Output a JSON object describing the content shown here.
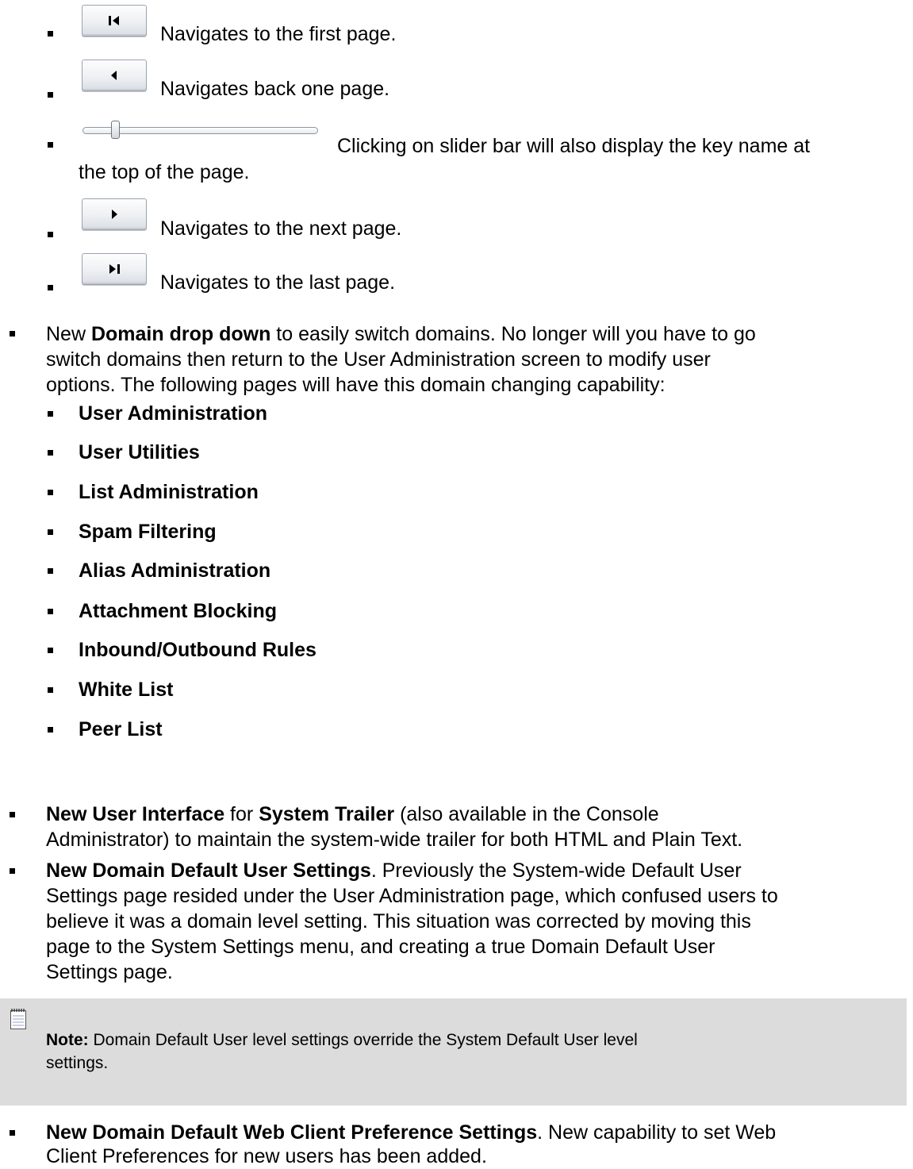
{
  "nav_buttons": [
    {
      "icon": "first-page-icon",
      "glyph": "▏◀",
      "description": "Navigates to the first page."
    },
    {
      "icon": "previous-page-icon",
      "glyph": "◀",
      "description": "Navigates back one page."
    },
    {
      "icon": "slider-bar",
      "description_line1": "Clicking on slider bar will also display the key name at",
      "description_line2": "the top of the page."
    },
    {
      "icon": "next-page-icon",
      "glyph": "▶",
      "description": "Navigates to the next page."
    },
    {
      "icon": "last-page-icon",
      "glyph": "▶▕",
      "description": "Navigates to the last page."
    }
  ],
  "domain_dropdown": {
    "prefix": "New ",
    "bold": "Domain drop down",
    "line1_rest": " to easily switch domains. No longer will you have to go",
    "line2": "switch domains then return to the User Administration screen to modify user",
    "line3": "options. The following pages will have this domain changing capability:",
    "pages": [
      "User Administration",
      "User Utilities",
      "List Administration",
      "Spam Filtering",
      "Alias Administration",
      "Attachment Blocking",
      "Inbound/Outbound Rules",
      "White List",
      "Peer List"
    ]
  },
  "system_trailer": {
    "bold1": "New User Interface",
    "mid": " for ",
    "bold2": "System Trailer",
    "line1_rest": " (also available in the Console",
    "line2": "Administrator) to maintain the system-wide trailer for both HTML and Plain Text."
  },
  "domain_default_user": {
    "bold": "New Domain Default User Settings",
    "line1_rest": ". Previously the System-wide Default User",
    "line2": "Settings page resided under the User Administration page, which confused users to",
    "line3": "believe it was a domain level setting. This situation was corrected by moving this",
    "line4": "page to the System Settings menu, and creating a true Domain Default User",
    "line5": "Settings page."
  },
  "note": {
    "icon": "notepad-icon",
    "label": "Note:",
    "line1_rest": " Domain Default User level settings override the System Default User level",
    "line2": "settings."
  },
  "web_client": {
    "bold": "New Domain Default Web Client Preference Settings",
    "line1_rest": ". New capability to set Web",
    "line2": "Client Preferences for new users has been added."
  },
  "colors": {
    "note_background": "#dcdcdc",
    "button_border": "#9ba3b0"
  }
}
